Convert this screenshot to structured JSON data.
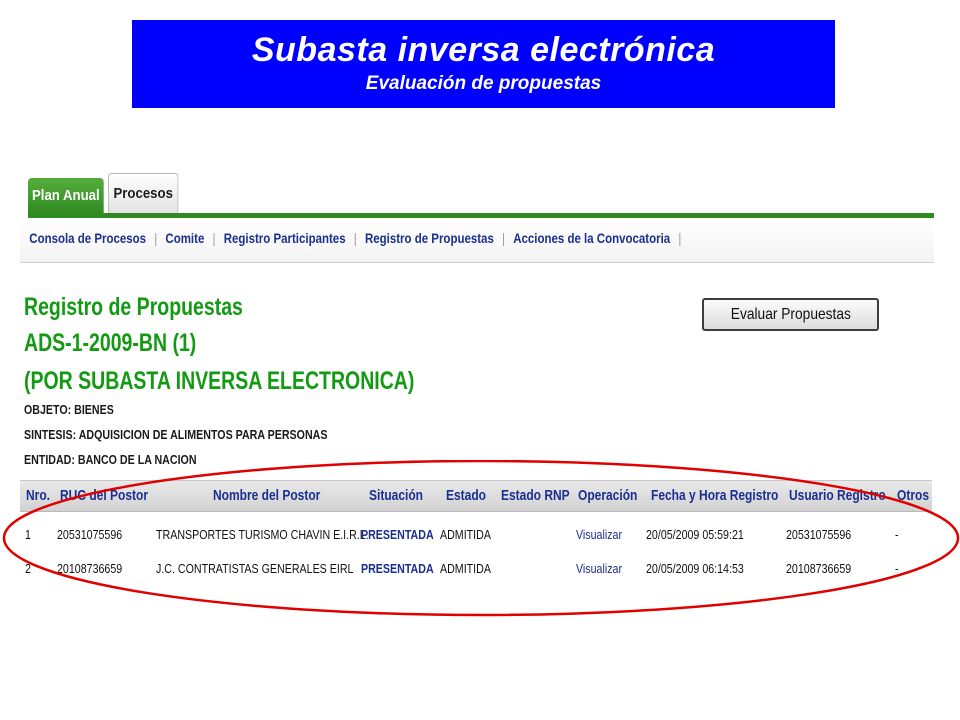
{
  "banner": {
    "title": "Subasta inversa electrónica",
    "subtitle": "Evaluación de propuestas",
    "bg_color": "#0000ff"
  },
  "tabs": [
    {
      "label": "Plan Anual",
      "active": false,
      "color": "#2f8a22"
    },
    {
      "label": "Procesos",
      "active": true
    }
  ],
  "nav": {
    "items": [
      {
        "label": "Consola de Procesos"
      },
      {
        "label": "Comite"
      },
      {
        "label": "Registro Participantes"
      },
      {
        "label": "Registro de Propuestas"
      },
      {
        "label": "Acciones de la Convocatoria"
      }
    ],
    "separator": "|"
  },
  "page": {
    "title_1": "Registro de Propuestas",
    "title_2": "ADS-1-2009-BN (1)",
    "title_3": "(POR SUBASTA INVERSA ELECTRONICA)",
    "objeto": "OBJETO: BIENES",
    "sintesis": "SINTESIS: ADQUISICION DE ALIMENTOS PARA PERSONAS",
    "entidad": "ENTIDAD: BANCO DE LA NACION",
    "title_color": "#139a13"
  },
  "evaluar_button": "Evaluar Propuestas",
  "table": {
    "headers": [
      "Nro.",
      "RUC del Postor",
      "Nombre del Postor",
      "Situación",
      "Estado",
      "Estado RNP",
      "Operación",
      "Fecha y Hora Registro",
      "Usuario Registro",
      "Otros"
    ],
    "rows": [
      {
        "nro": "1",
        "ruc": "20531075596",
        "nombre": "TRANSPORTES TURISMO CHAVIN E.I.R.L.",
        "situacion": "PRESENTADA",
        "estado": "ADMITIDA",
        "estado_rnp": "",
        "operacion": "Visualizar",
        "fecha": "20/05/2009 05:59:21",
        "usuario": "20531075596",
        "otros": "-"
      },
      {
        "nro": "2",
        "ruc": "20108736659",
        "nombre": "J.C. CONTRATISTAS GENERALES EIRL",
        "situacion": "PRESENTADA",
        "estado": "ADMITIDA",
        "estado_rnp": "",
        "operacion": "Visualizar",
        "fecha": "20/05/2009 06:14:53",
        "usuario": "20108736659",
        "otros": "-"
      }
    ]
  },
  "highlight_color": "#e00000"
}
